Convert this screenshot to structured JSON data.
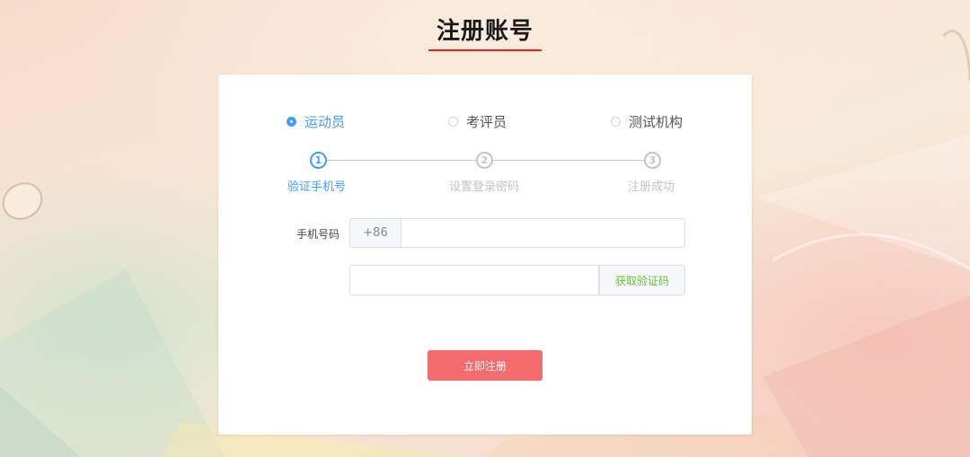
{
  "page": {
    "title": "注册账号"
  },
  "roles": [
    {
      "label": "运动员",
      "selected": true
    },
    {
      "label": "考评员",
      "selected": false
    },
    {
      "label": "测试机构",
      "selected": false
    }
  ],
  "steps": [
    {
      "number": "1",
      "label": "验证手机号",
      "active": true
    },
    {
      "number": "2",
      "label": "设置登录密码",
      "active": false
    },
    {
      "number": "3",
      "label": "注册成功",
      "active": false
    }
  ],
  "form": {
    "phone_label": "手机号码",
    "country_code": "+86",
    "phone_value": "",
    "code_value": "",
    "get_code_label": "获取验证码"
  },
  "submit_label": "立即注册",
  "colors": {
    "title_underline": "#e0231f",
    "active_blue": "#409eff",
    "submit_red": "#f56c6c",
    "code_green": "#67c23a"
  }
}
